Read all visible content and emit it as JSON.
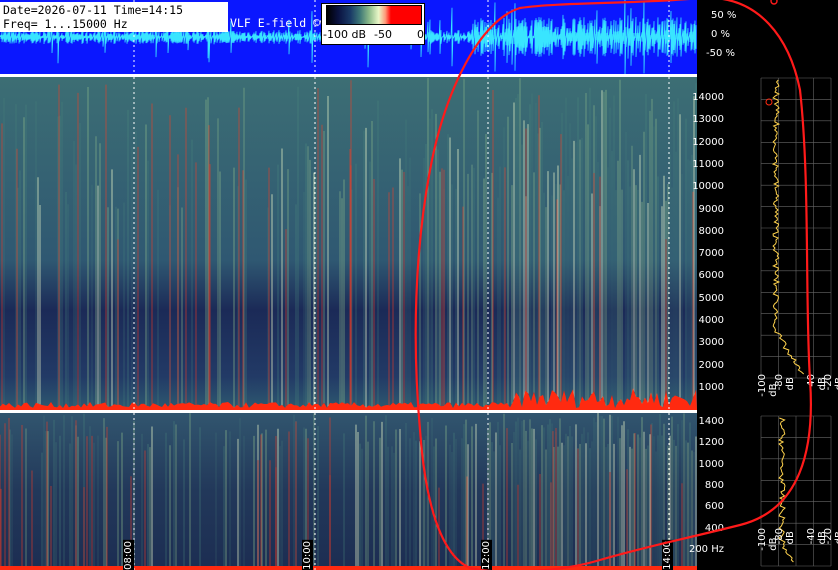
{
  "info": {
    "date_line": "Date=2026-07-11 Time=14:15",
    "freq_line": "Freq= 1...15000 Hz",
    "source": "VLF E-field ©www.vlf.it"
  },
  "colorbar": {
    "labels": [
      "-100 dB",
      "-50",
      "0"
    ],
    "colors": [
      "#000000",
      "#1a3a66",
      "#3d7777",
      "#e9f7c8",
      "#ff0000"
    ]
  },
  "waveform_scale": [
    "50 %",
    "0 %",
    "-50 %"
  ],
  "upper_freq_ticks": [
    "14000",
    "13000",
    "12000",
    "11000",
    "10000",
    "9000",
    "8000",
    "7000",
    "6000",
    "5000",
    "4000",
    "3000",
    "2000",
    "1000"
  ],
  "lower_freq_ticks": [
    "1400",
    "1200",
    "1000",
    "800",
    "600",
    "400",
    "200 Hz"
  ],
  "upper_db_ticks": [
    "-100 dB",
    "-80 dB",
    "-40 dB",
    "-20 dB"
  ],
  "lower_db_ticks": [
    "-100 dB",
    "-80 dB",
    "-40 dB",
    "-20 dB"
  ],
  "time_labels": [
    "08:00",
    "10:00",
    "12:00",
    "14:00"
  ],
  "colors": {
    "background": "#000000",
    "waveform_bg": "#0a17ff",
    "annotation": "#ff0000",
    "spectrum_trace": "#ffd34d"
  }
}
